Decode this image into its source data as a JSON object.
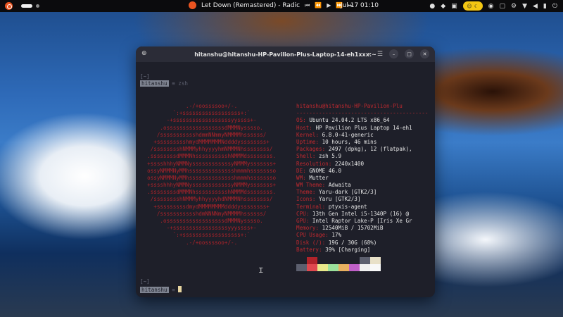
{
  "topbar": {
    "media_title": "Let Down (Remastered) - Radic",
    "clock": "Jul 17  01:10",
    "colors": {
      "bar": "#0b0b0d",
      "accent": "#e95420",
      "pill": "#f3c613"
    }
  },
  "terminal": {
    "title": "hitanshu@hitanshu-HP-Pavilion-Plus-Laptop-14-eh1xxx:~",
    "prompt_top": "[~]",
    "user": "hitanshu",
    "command": " ≡ zsh",
    "prompt_bottom_top": "[~]",
    "prompt_bottom_suffix": " ≡ ",
    "header_line": "hitanshu@hitanshu-HP-Pavilion-Plu",
    "separator": "-----------------------------------------",
    "info": [
      {
        "key": "OS",
        "value": "Ubuntu 24.04.2 LTS x86_64"
      },
      {
        "key": "Host",
        "value": "HP Pavilion Plus Laptop 14-eh1"
      },
      {
        "key": "Kernel",
        "value": "6.8.0-41-generic"
      },
      {
        "key": "Uptime",
        "value": "10 hours, 46 mins"
      },
      {
        "key": "Packages",
        "value": "2497 (dpkg), 12 (flatpak),"
      },
      {
        "key": "Shell",
        "value": "zsh 5.9"
      },
      {
        "key": "Resolution",
        "value": "2240x1400"
      },
      {
        "key": "DE",
        "value": "GNOME 46.0"
      },
      {
        "key": "WM",
        "value": "Mutter"
      },
      {
        "key": "WM Theme",
        "value": "Adwaita"
      },
      {
        "key": "Theme",
        "value": "Yaru-dark [GTK2/3]"
      },
      {
        "key": "Icons",
        "value": "Yaru [GTK2/3]"
      },
      {
        "key": "Terminal",
        "value": "ptyxis-agent"
      },
      {
        "key": "CPU",
        "value": "13th Gen Intel i5-1340P (16) @"
      },
      {
        "key": "GPU",
        "value": "Intel Raptor Lake-P [Iris Xe Gr"
      },
      {
        "key": "Memory",
        "value": "12540MiB / 15702MiB"
      },
      {
        "key": "CPU Usage",
        "value": "17%"
      },
      {
        "key": "Disk (/)",
        "value": "19G / 30G (68%)"
      },
      {
        "key": "Battery",
        "value": "39% [Charging]"
      }
    ],
    "logo_lines": [
      "              .-/+oossssoo+/-.",
      "          `:+ssssssssssssssssss+:`",
      "        -+ssssssssssssssssssyyssss+-",
      "      .ossssssssssssssssssdMMMNysssso.",
      "     /ssssssssssshdmmNNmmyNMMMMhssssss/",
      "    +ssssssssshmydMMMMMMMNddddyssssssss+",
      "   /sssssssshNMMMyhhyyyyhmNMMMNhssssssss/",
      "  .ssssssssdMMMNhsssssssssshNMMMdssssssss.",
      "  +sssshhhyNMMNyssssssssssssyNMMMysssssss+",
      "  ossyNMMMNyMMhsssssssssssssshmmmhssssssso",
      "  ossyNMMMNyMMhsssssssssssssshmmmhssssssso",
      "  +sssshhhyNMMNyssssssssssssyNMMMysssssss+",
      "  .ssssssssdMMMNhsssssssssshNMMMdssssssss.",
      "   /sssssssshNMMMyhhyyyyhdNMMMNhssssssss/",
      "    +sssssssssdmydMMMMMMMMddddyssssssss+",
      "     /ssssssssssshdmNNNNmyNMMMMhssssss/",
      "      .ossssssssssssssssssdMMMNysssso.",
      "        -+sssssssssssssssssyyyssss+-",
      "          `:+ssssssssssssssssss+:`",
      "              .-/+oossssoo+/-."
    ],
    "palette_top": [
      "#1e1f29",
      "#b0232a",
      "#1e1f29",
      "#1e1f29",
      "#1e1f29",
      "#1e1f29",
      "#5c5f6e",
      "#e8e0c8"
    ],
    "palette_bottom": [
      "#5c5f6e",
      "#e0484f",
      "#e8e88a",
      "#9be09b",
      "#e8b060",
      "#c060c8",
      "#f0f0f0",
      "#f8f8f8"
    ]
  }
}
